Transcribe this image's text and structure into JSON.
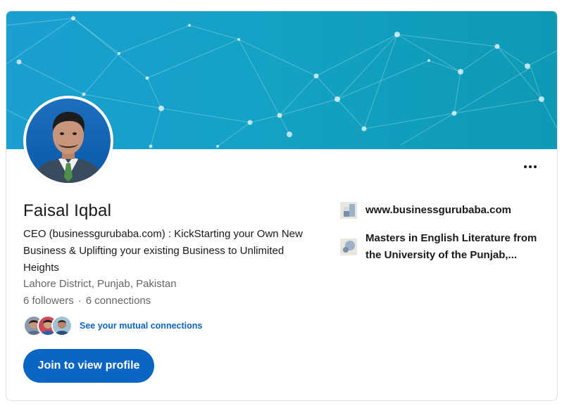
{
  "profile": {
    "name": "Faisal Iqbal",
    "headline": "CEO (businessgurubaba.com) : KickStarting your Own New Business & Uplifting your existing Business to Unlimited Heights",
    "location": "Lahore District, Punjab, Pakistan",
    "followers": "6 followers",
    "separator": "·",
    "connections": "6 connections",
    "mutual_connections_link": "See your mutual connections",
    "join_button": "Join to view profile",
    "more_icon": "more-horizontal-icon"
  },
  "sidebar": {
    "website": "www.businessgurubaba.com",
    "website_icon": "company-logo-icon",
    "education": "Masters in English Literature from the University of the Punjab,...",
    "education_icon": "school-logo-icon"
  },
  "colors": {
    "accent": "#0a66c2",
    "banner_start": "#1a9fd0",
    "banner_end": "#0d9ab5"
  }
}
